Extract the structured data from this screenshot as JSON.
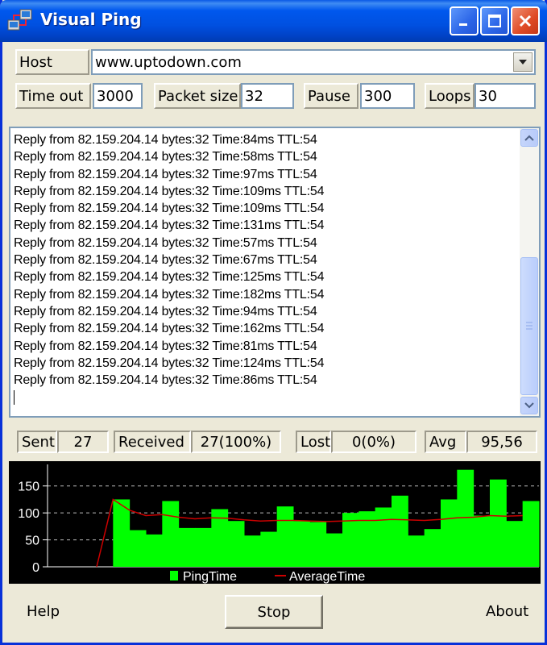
{
  "window": {
    "title": "Visual Ping"
  },
  "host": {
    "label": "Host",
    "value": "www.uptodown.com"
  },
  "settings": {
    "timeout_label": "Time out",
    "timeout_value": "3000",
    "packet_label": "Packet size",
    "packet_value": "32",
    "pause_label": "Pause",
    "pause_value": "300",
    "loops_label": "Loops",
    "loops_value": "30"
  },
  "log": [
    "Reply from 82.159.204.14 bytes:32 Time:84ms TTL:54",
    "Reply from 82.159.204.14 bytes:32 Time:58ms TTL:54",
    "Reply from 82.159.204.14 bytes:32 Time:97ms TTL:54",
    "Reply from 82.159.204.14 bytes:32 Time:109ms TTL:54",
    "Reply from 82.159.204.14 bytes:32 Time:109ms TTL:54",
    "Reply from 82.159.204.14 bytes:32 Time:131ms TTL:54",
    "Reply from 82.159.204.14 bytes:32 Time:57ms TTL:54",
    "Reply from 82.159.204.14 bytes:32 Time:67ms TTL:54",
    "Reply from 82.159.204.14 bytes:32 Time:125ms TTL:54",
    "Reply from 82.159.204.14 bytes:32 Time:182ms TTL:54",
    "Reply from 82.159.204.14 bytes:32 Time:94ms TTL:54",
    "Reply from 82.159.204.14 bytes:32 Time:162ms TTL:54",
    "Reply from 82.159.204.14 bytes:32 Time:81ms TTL:54",
    "Reply from 82.159.204.14 bytes:32 Time:124ms TTL:54",
    "Reply from 82.159.204.14 bytes:32 Time:86ms TTL:54"
  ],
  "stats": {
    "sent_label": "Sent",
    "sent_value": "27",
    "received_label": "Received",
    "received_value": "27(100%)",
    "lost_label": "Lost",
    "lost_value": "0(0%)",
    "avg_label": "Avg",
    "avg_value": "95,56"
  },
  "chart_data": {
    "type": "bar",
    "yticks": [
      "150",
      "100",
      "50",
      "0"
    ],
    "ylim": [
      0,
      190
    ],
    "series": [
      {
        "name": "PingTime",
        "color": "#00ff00",
        "values": [
          0,
          0,
          0,
          0,
          125,
          68,
          60,
          122,
          72,
          72,
          107,
          85,
          58,
          65,
          112,
          85,
          83,
          62,
          100,
          103,
          110,
          132,
          58,
          70,
          125,
          180,
          95,
          162,
          85,
          122
        ]
      },
      {
        "name": "AverageTime",
        "color": "#cc0000",
        "values": [
          null,
          null,
          null,
          0,
          125,
          105,
          95,
          97,
          92,
          89,
          91,
          90,
          87,
          85,
          86,
          86,
          85,
          84,
          85,
          86,
          86,
          88,
          87,
          86,
          88,
          91,
          92,
          95,
          94,
          95
        ]
      }
    ],
    "legend_position": "bottom",
    "grid": true
  },
  "footer": {
    "help": "Help",
    "stop": "Stop",
    "about": "About"
  }
}
